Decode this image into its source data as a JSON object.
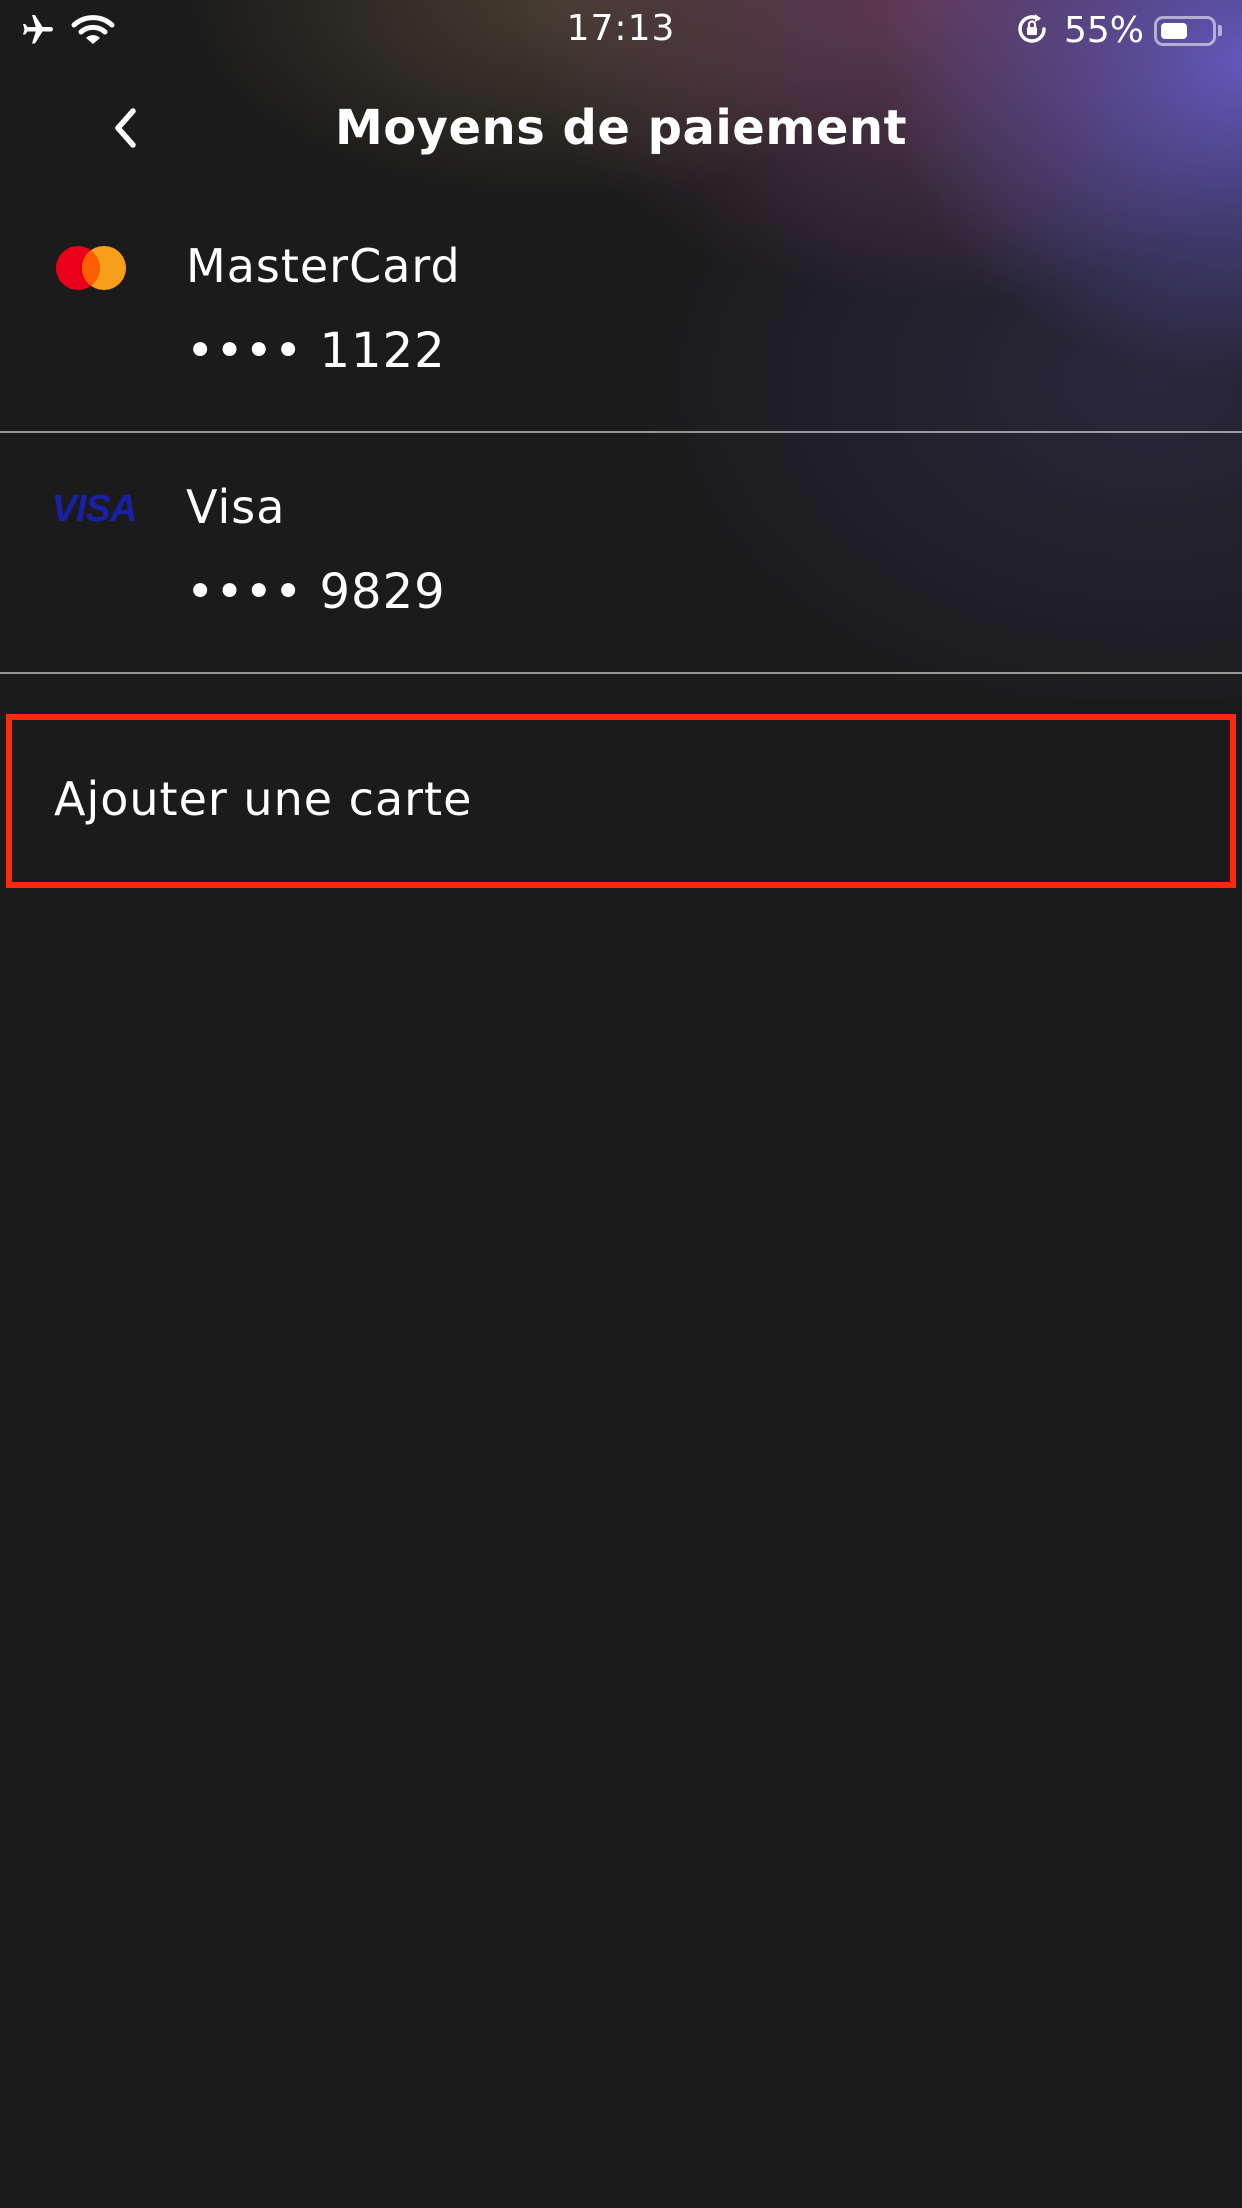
{
  "status_bar": {
    "time": "17:13",
    "battery_percent": "55%",
    "battery_level": 0.55,
    "icons": [
      "airplane-icon",
      "wifi-icon",
      "rotation-lock-icon",
      "battery-icon"
    ]
  },
  "header": {
    "title": "Moyens de paiement",
    "back_icon": "chevron-left-icon"
  },
  "cards": [
    {
      "brand": "MasterCard",
      "number": "•••• 1122",
      "icon": "mastercard-logo-icon"
    },
    {
      "brand": "Visa",
      "number": "•••• 9829",
      "icon": "visa-logo-icon",
      "logo_text": "VISA"
    }
  ],
  "add_card": {
    "label": "Ajouter une carte",
    "highlight_color": "#ff2a0d"
  },
  "colors": {
    "background": "#1b1b1b",
    "text": "#ffffff",
    "mastercard_red": "#eb001b",
    "mastercard_orange": "#f79e1b",
    "visa_blue": "#1a1fa8"
  }
}
